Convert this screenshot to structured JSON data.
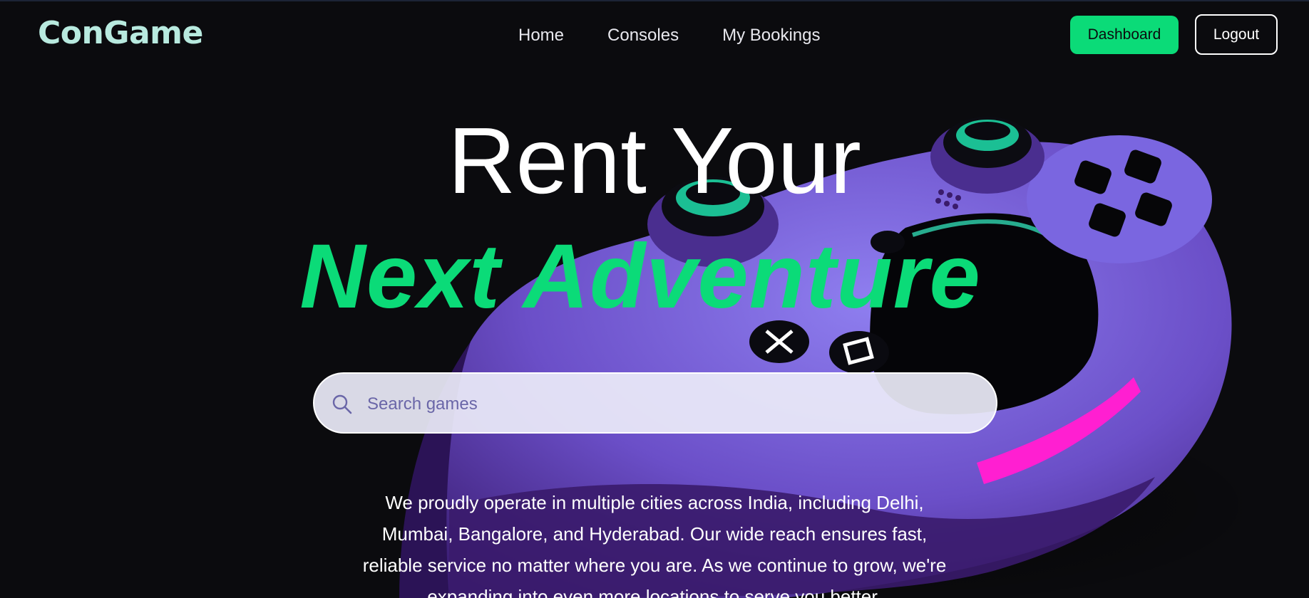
{
  "brand": {
    "logo": "ConGame"
  },
  "nav": {
    "links": [
      {
        "label": "Home"
      },
      {
        "label": "Consoles"
      },
      {
        "label": "My Bookings"
      }
    ],
    "dashboard_label": "Dashboard",
    "logout_label": "Logout"
  },
  "hero": {
    "line1": "Rent Your",
    "line2": "Next Adventure"
  },
  "search": {
    "placeholder": "Search games",
    "value": ""
  },
  "description": "We proudly operate in multiple cities across India, including Delhi, Mumbai, Bangalore, and Hyderabad. Our wide reach ensures fast, reliable service no matter where you are. As we continue to grow, we're expanding into even more locations to serve you better.",
  "colors": {
    "accent": "#0bdb78",
    "logo": "#b8eadf",
    "background": "#0b0b0e",
    "controller": "#7b5fd6"
  },
  "icons": {
    "search": "search-icon",
    "hero_image": "gamepad-icon"
  }
}
